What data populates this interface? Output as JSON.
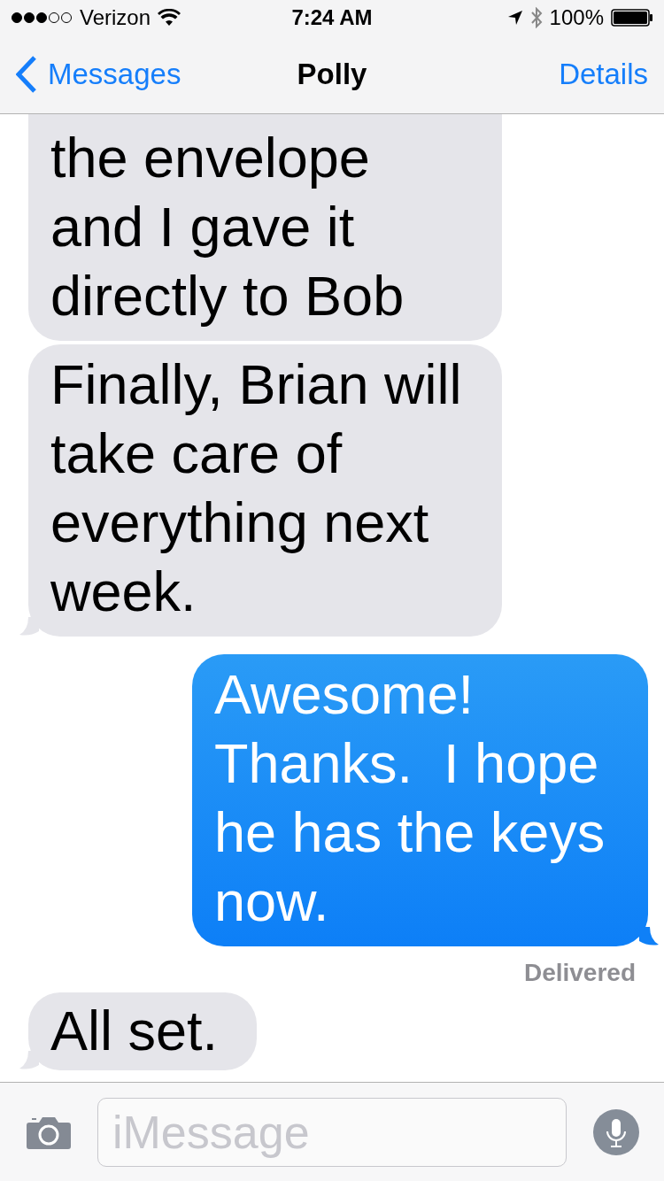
{
  "status_bar": {
    "carrier": "Verizon",
    "time": "7:24 AM",
    "battery": "100%"
  },
  "nav": {
    "back": "Messages",
    "title": "Polly",
    "action": "Details"
  },
  "messages": [
    {
      "kind": "received",
      "text": "the envelope and I gave it directly to Bob",
      "cut_top": true,
      "tail": false
    },
    {
      "kind": "received",
      "text": "Finally, Brian will take care of everything next week.",
      "cut_top": false,
      "tail": true
    },
    {
      "kind": "sent",
      "text": "Awesome! Thanks.  I hope he has the keys now.",
      "cut_top": false,
      "tail": true
    },
    {
      "kind": "status",
      "text": "Delivered"
    },
    {
      "kind": "received",
      "text": "All set.",
      "cut_top": false,
      "tail": true
    }
  ],
  "composer": {
    "placeholder": "iMessage"
  }
}
